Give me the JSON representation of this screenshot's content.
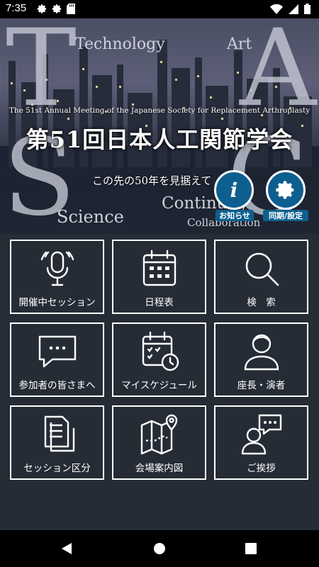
{
  "status_bar": {
    "time": "7:35"
  },
  "hero": {
    "letters": {
      "t": "T",
      "a": "A",
      "s": "S",
      "c": "C"
    },
    "words": {
      "technology": "Technology",
      "art": "Art",
      "science": "Science",
      "continuity": "Continuity",
      "collaboration": "Collaboration"
    },
    "subtitle_en": "The 51st Annual Meeting of the Japanese Society for Replacement Arthroplasty",
    "title_jp": "第51回日本人工関節学会",
    "tagline": "この先の50年を見据えて",
    "info_button": {
      "icon_text": "i",
      "label": "お知らせ"
    },
    "settings_button": {
      "label": "同期/設定"
    }
  },
  "menu": [
    {
      "icon": "microphone-icon",
      "label": "開催中セッション"
    },
    {
      "icon": "calendar-icon",
      "label": "日程表"
    },
    {
      "icon": "search-icon",
      "label": "検　索"
    },
    {
      "icon": "chat-bubble-icon",
      "label": "参加者の皆さまへ"
    },
    {
      "icon": "calendar-clock-icon",
      "label": "マイスケジュール"
    },
    {
      "icon": "person-icon",
      "label": "座長・演者"
    },
    {
      "icon": "documents-icon",
      "label": "セッション区分"
    },
    {
      "icon": "map-icon",
      "label": "会場案内図"
    },
    {
      "icon": "greeting-icon",
      "label": "ご挨拶"
    }
  ],
  "colors": {
    "background": "#262c36",
    "accent": "#0d5f8f",
    "tile_border": "#ffffff"
  }
}
